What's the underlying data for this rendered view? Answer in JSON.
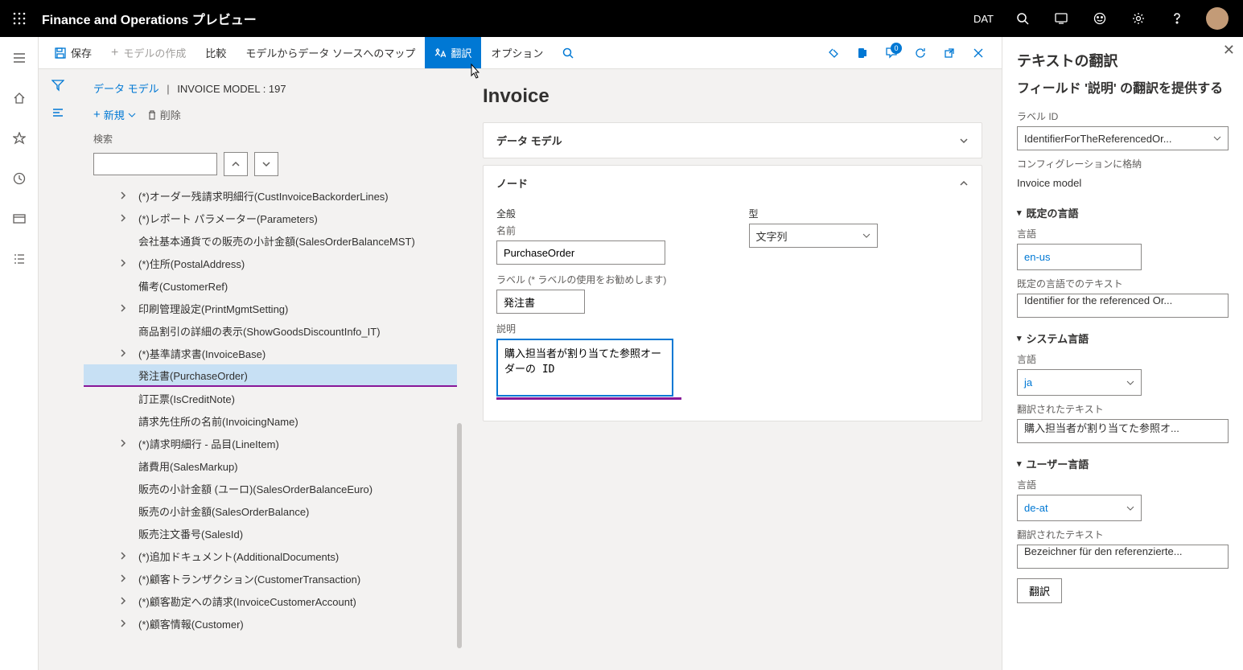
{
  "topbar": {
    "app_title": "Finance and Operations プレビュー",
    "company": "DAT"
  },
  "cmdbar": {
    "save": "保存",
    "create_model": "モデルの作成",
    "compare": "比較",
    "map_model": "モデルからデータ ソースへのマップ",
    "translate": "翻訳",
    "options": "オプション",
    "badge": "0"
  },
  "breadcrumb": {
    "root": "データ モデル",
    "current": "INVOICE MODEL : 197"
  },
  "tree_toolbar": {
    "new": "新規",
    "delete": "削除"
  },
  "search_label": "検索",
  "tree": [
    {
      "label": "(*)オーダー残請求明細行(CustInvoiceBackorderLines)",
      "expandable": true
    },
    {
      "label": "(*)レポート パラメーター(Parameters)",
      "expandable": true
    },
    {
      "label": "会社基本通貨での販売の小計金額(SalesOrderBalanceMST)",
      "expandable": false
    },
    {
      "label": "(*)住所(PostalAddress)",
      "expandable": true
    },
    {
      "label": "備考(CustomerRef)",
      "expandable": false
    },
    {
      "label": "印刷管理設定(PrintMgmtSetting)",
      "expandable": true
    },
    {
      "label": "商品割引の詳細の表示(ShowGoodsDiscountInfo_IT)",
      "expandable": false
    },
    {
      "label": "(*)基準請求書(InvoiceBase)",
      "expandable": true
    },
    {
      "label": "発注書(PurchaseOrder)",
      "expandable": false,
      "selected": true
    },
    {
      "label": "訂正票(IsCreditNote)",
      "expandable": false
    },
    {
      "label": "請求先住所の名前(InvoicingName)",
      "expandable": false
    },
    {
      "label": "(*)請求明細行 - 品目(LineItem)",
      "expandable": true
    },
    {
      "label": "諸費用(SalesMarkup)",
      "expandable": false
    },
    {
      "label": "販売の小計金額 (ユーロ)(SalesOrderBalanceEuro)",
      "expandable": false
    },
    {
      "label": "販売の小計金額(SalesOrderBalance)",
      "expandable": false
    },
    {
      "label": "販売注文番号(SalesId)",
      "expandable": false
    },
    {
      "label": "(*)追加ドキュメント(AdditionalDocuments)",
      "expandable": true
    },
    {
      "label": "(*)顧客トランザクション(CustomerTransaction)",
      "expandable": true
    },
    {
      "label": "(*)顧客勘定への請求(InvoiceCustomerAccount)",
      "expandable": true
    },
    {
      "label": "(*)顧客情報(Customer)",
      "expandable": true
    }
  ],
  "page": {
    "title": "Invoice",
    "section_model": "データ モデル",
    "section_node": "ノード",
    "general": "全般",
    "type_label": "型",
    "type_value": "文字列",
    "name_label": "名前",
    "name_value": "PurchaseOrder",
    "label_label": "ラベル (* ラベルの使用をお勧めします)",
    "label_value": "発注書",
    "desc_label": "説明",
    "desc_value": "購入担当者が割り当てた参照オーダーの ID"
  },
  "sidepane": {
    "title": "テキストの翻訳",
    "subtitle": "フィールド '説明' の翻訳を提供する",
    "label_id_label": "ラベル ID",
    "label_id_value": "IdentifierForTheReferencedOr...",
    "stored_in_label": "コンフィグレーションに格納",
    "stored_in_value": "Invoice model",
    "default_lang_header": "既定の言語",
    "lang_label": "言語",
    "default_lang_value": "en-us",
    "default_text_label": "既定の言語でのテキスト",
    "default_text_value": "Identifier for the referenced Or...",
    "system_lang_header": "システム言語",
    "system_lang_value": "ja",
    "translated_label": "翻訳されたテキスト",
    "system_translated": "購入担当者が割り当てた参照オ...",
    "user_lang_header": "ユーザー言語",
    "user_lang_value": "de-at",
    "user_translated": "Bezeichner für den referenzierte...",
    "translate_btn": "翻訳"
  }
}
